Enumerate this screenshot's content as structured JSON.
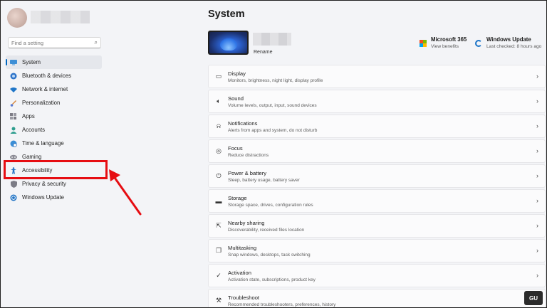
{
  "sidebar": {
    "search": {
      "placeholder": "Find a setting",
      "icon": "search-icon"
    },
    "items": [
      {
        "label": "System",
        "icon": "monitor-icon",
        "active": true
      },
      {
        "label": "Bluetooth & devices",
        "icon": "bluetooth-icon"
      },
      {
        "label": "Network & internet",
        "icon": "wifi-icon"
      },
      {
        "label": "Personalization",
        "icon": "brush-icon"
      },
      {
        "label": "Apps",
        "icon": "apps-icon"
      },
      {
        "label": "Accounts",
        "icon": "person-icon"
      },
      {
        "label": "Time & language",
        "icon": "globe-clock-icon"
      },
      {
        "label": "Gaming",
        "icon": "gamepad-icon"
      },
      {
        "label": "Accessibility",
        "icon": "accessibility-icon"
      },
      {
        "label": "Privacy & security",
        "icon": "shield-icon"
      },
      {
        "label": "Windows Update",
        "icon": "sync-icon"
      }
    ]
  },
  "main": {
    "title": "System",
    "device": {
      "rename_label": "Rename"
    },
    "microsoft365": {
      "title": "Microsoft 365",
      "subtitle": "View benefits"
    },
    "windows_update": {
      "title": "Windows Update",
      "subtitle": "Last checked: 8 hours ago"
    },
    "cards": [
      {
        "title": "Display",
        "subtitle": "Monitors, brightness, night light, display profile",
        "icon": "display-icon"
      },
      {
        "title": "Sound",
        "subtitle": "Volume levels, output, input, sound devices",
        "icon": "speaker-icon"
      },
      {
        "title": "Notifications",
        "subtitle": "Alerts from apps and system, do not disturb",
        "icon": "bell-icon"
      },
      {
        "title": "Focus",
        "subtitle": "Reduce distractions",
        "icon": "focus-icon"
      },
      {
        "title": "Power & battery",
        "subtitle": "Sleep, battery usage, battery saver",
        "icon": "power-icon"
      },
      {
        "title": "Storage",
        "subtitle": "Storage space, drives, configuration rules",
        "icon": "storage-icon"
      },
      {
        "title": "Nearby sharing",
        "subtitle": "Discoverability, received files location",
        "icon": "share-icon"
      },
      {
        "title": "Multitasking",
        "subtitle": "Snap windows, desktops, task switching",
        "icon": "multitask-icon"
      },
      {
        "title": "Activation",
        "subtitle": "Activation state, subscriptions, product key",
        "icon": "check-circle-icon"
      },
      {
        "title": "Troubleshoot",
        "subtitle": "Recommended troubleshooters, preferences, history",
        "icon": "wrench-icon"
      }
    ]
  },
  "colors": {
    "accent": "#0067c0",
    "annotation": "#e60d12"
  }
}
